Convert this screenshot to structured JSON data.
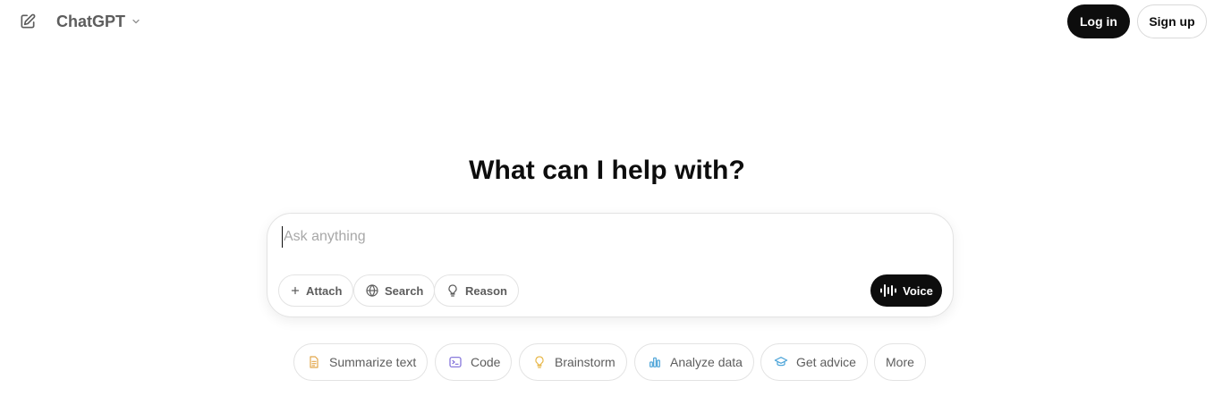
{
  "header": {
    "model_name": "ChatGPT",
    "login_label": "Log in",
    "signup_label": "Sign up",
    "icons": {
      "new_chat": "edit-icon",
      "model_dropdown": "chevron-down-icon"
    }
  },
  "main": {
    "title": "What can I help with?"
  },
  "composer": {
    "placeholder": "Ask anything",
    "value": "",
    "tools": [
      {
        "label": "Attach",
        "icon": "plus-icon"
      },
      {
        "label": "Search",
        "icon": "globe-icon"
      },
      {
        "label": "Reason",
        "icon": "lightbulb-icon"
      }
    ],
    "voice_label": "Voice"
  },
  "suggestions": [
    {
      "label": "Summarize text",
      "icon": "document-icon",
      "color": "#e2a64a"
    },
    {
      "label": "Code",
      "icon": "terminal-icon",
      "color": "#7b6ad8"
    },
    {
      "label": "Brainstorm",
      "icon": "lightbulb-icon",
      "color": "#e8b84a"
    },
    {
      "label": "Analyze data",
      "icon": "bar-chart-icon",
      "color": "#4aa3d8"
    },
    {
      "label": "Get advice",
      "icon": "graduation-cap-icon",
      "color": "#4aa3d8"
    },
    {
      "label": "More",
      "icon": "",
      "color": ""
    }
  ],
  "colors": {
    "primary": "#0d0d0d",
    "muted_text": "#5d5d5d",
    "border": "#e3e3e3",
    "background": "#ffffff"
  }
}
